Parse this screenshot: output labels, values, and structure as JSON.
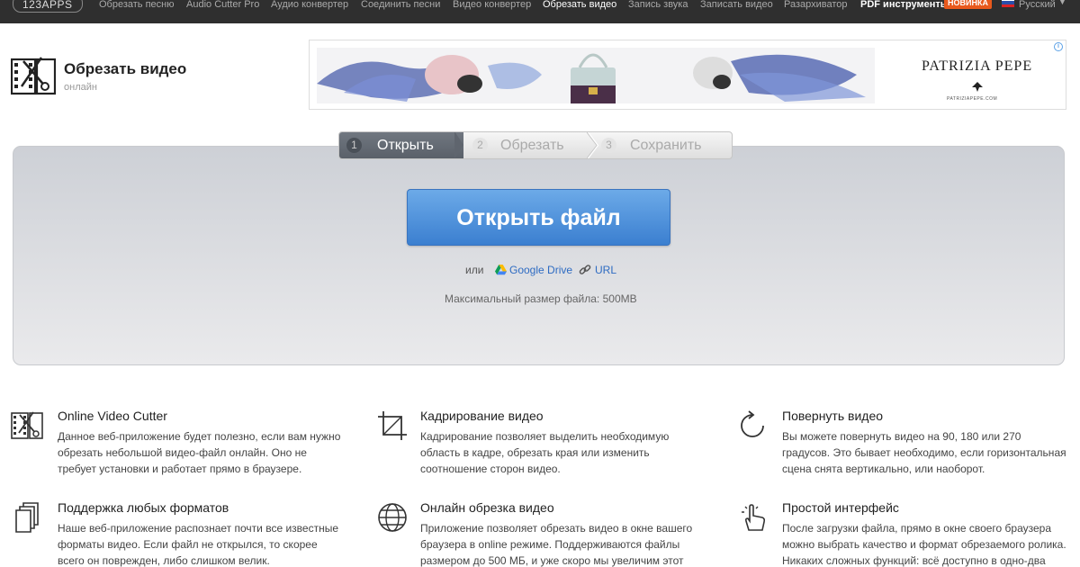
{
  "nav": {
    "logo": "123APPS",
    "items": [
      {
        "label": "Обрезать песню"
      },
      {
        "label": "Audio Cutter Pro"
      },
      {
        "label": "Аудио конвертер"
      },
      {
        "label": "Соединить песни"
      },
      {
        "label": "Видео конвертер"
      },
      {
        "label": "Обрезать видео"
      },
      {
        "label": "Запись звука"
      },
      {
        "label": "Записать видео"
      },
      {
        "label": "Разархиватор"
      },
      {
        "label": "PDF инструменты"
      }
    ],
    "badge": "НОВИНКА",
    "language": "Русский"
  },
  "app": {
    "title": "Обрезать видео",
    "subtitle": "онлайн"
  },
  "ad": {
    "brand": "PATRIZIA PEPE",
    "site": "PATRIZIAPEPE.COM",
    "info": "i"
  },
  "steps": [
    {
      "num": "1",
      "label": "Открыть"
    },
    {
      "num": "2",
      "label": "Обрезать"
    },
    {
      "num": "3",
      "label": "Сохранить"
    }
  ],
  "open_button": "Открыть файл",
  "or_label": "или",
  "google_drive": "Google Drive",
  "url_label": "URL",
  "max_size": "Максимальный размер файла: 500MB",
  "features": [
    {
      "title": "Online Video Cutter",
      "text": "Данное веб-приложение будет полезно, если вам нужно обрезать небольшой видео-файл онлайн. Оно не требует установки и работает прямо в браузере.",
      "icon": "film-scissors-icon"
    },
    {
      "title": "Кадрирование видео",
      "text": "Кадрирование позволяет выделить необходимую область в кадре, обрезать края или изменить соотношение сторон видео.",
      "icon": "crop-icon"
    },
    {
      "title": "Повернуть видео",
      "text": "Вы можете повернуть видео на 90, 180 или 270 градусов. Это бывает необходимо, если горизонтальная сцена снята вертикально, или наоборот.",
      "icon": "rotate-icon"
    },
    {
      "title": "Поддержка любых форматов",
      "text": "Наше веб-приложение распознает почти все известные форматы видео. Если файл не открылся, то скорее всего он поврежден, либо слишком велик.",
      "icon": "files-icon"
    },
    {
      "title": "Онлайн обрезка видео",
      "text": "Приложение позволяет обрезать видео в окне вашего браузера в online режиме. Поддерживаются файлы размером до 500 МБ, и уже скоро мы увеличим этот",
      "icon": "globe-icon"
    },
    {
      "title": "Простой интерфейс",
      "text": "После загрузки файла, прямо в окне своего браузера можно выбрать качество и формат обрезаемого ролика. Никаких сложных функций: всё доступно в одно-два",
      "icon": "hand-pointer-icon"
    }
  ]
}
